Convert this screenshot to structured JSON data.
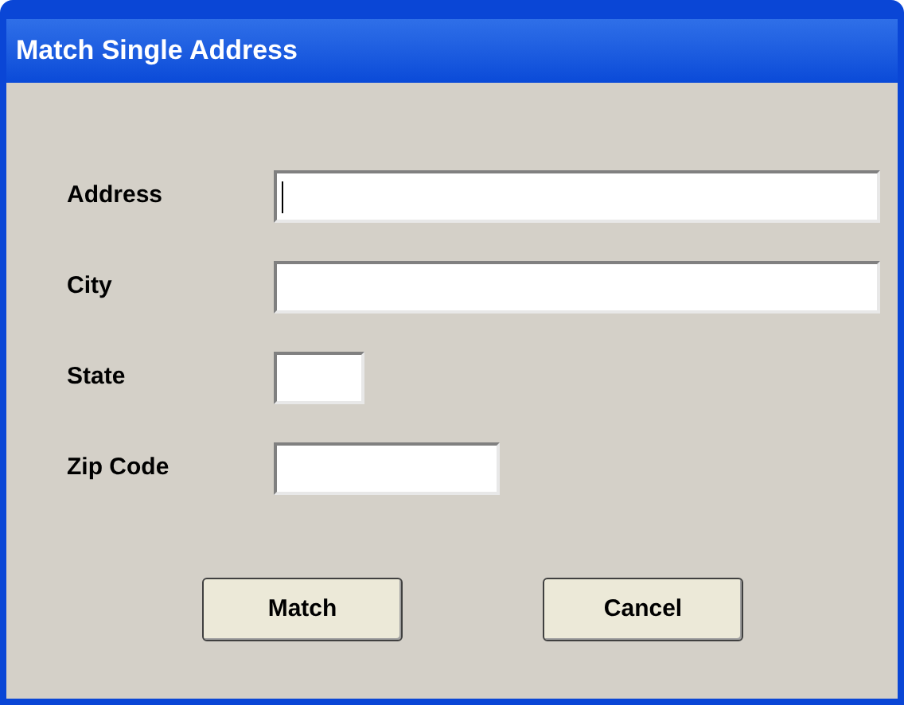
{
  "window": {
    "title": "Match Single Address"
  },
  "fields": [
    {
      "label": "Address",
      "focused": true
    },
    {
      "label": "City",
      "focused": false
    },
    {
      "label": "State",
      "focused": false
    },
    {
      "label": "Zip Code",
      "focused": false
    }
  ],
  "buttons": [
    "Match",
    "Cancel"
  ]
}
